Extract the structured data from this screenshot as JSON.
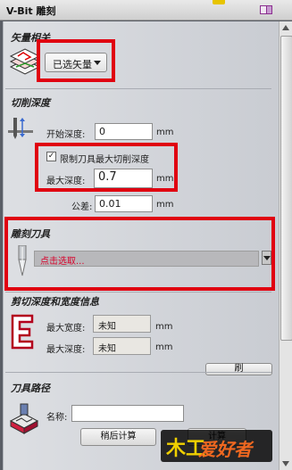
{
  "window": {
    "title": "V-Bit 雕刻"
  },
  "vector": {
    "section_title": "矢量相关",
    "selector_label": "已选矢量"
  },
  "cut_depth": {
    "section_title": "切削深度",
    "start_depth_label": "开始深度:",
    "start_depth_value": "0",
    "unit": "mm",
    "limit_checkbox_label": "限制刀具最大切削深度",
    "limit_checked": true,
    "max_depth_label": "最大深度:",
    "max_depth_value": "0.7",
    "tolerance_label": "公差:",
    "tolerance_value": "0.01"
  },
  "tool": {
    "section_title": "雕刻刀具",
    "select_placeholder": "点击选取..."
  },
  "info": {
    "section_title": "剪切深度和宽度信息",
    "max_width_label": "最大宽度:",
    "max_width_value": "未知",
    "max_depth_label": "最大深度:",
    "max_depth_value": "未知",
    "unit": "mm",
    "cut_button_label": "刷"
  },
  "toolpath": {
    "section_title": "刀具路径",
    "name_label": "名称:",
    "name_value": "",
    "calc_later_label": "稍后计算",
    "calc_label": "计算"
  },
  "watermark": {
    "text1": "木工",
    "text2": "爱好者"
  },
  "colors": {
    "highlight": "#e00010",
    "panel_bg": "#d2d5da",
    "tool_placeholder": "#d8002a"
  }
}
